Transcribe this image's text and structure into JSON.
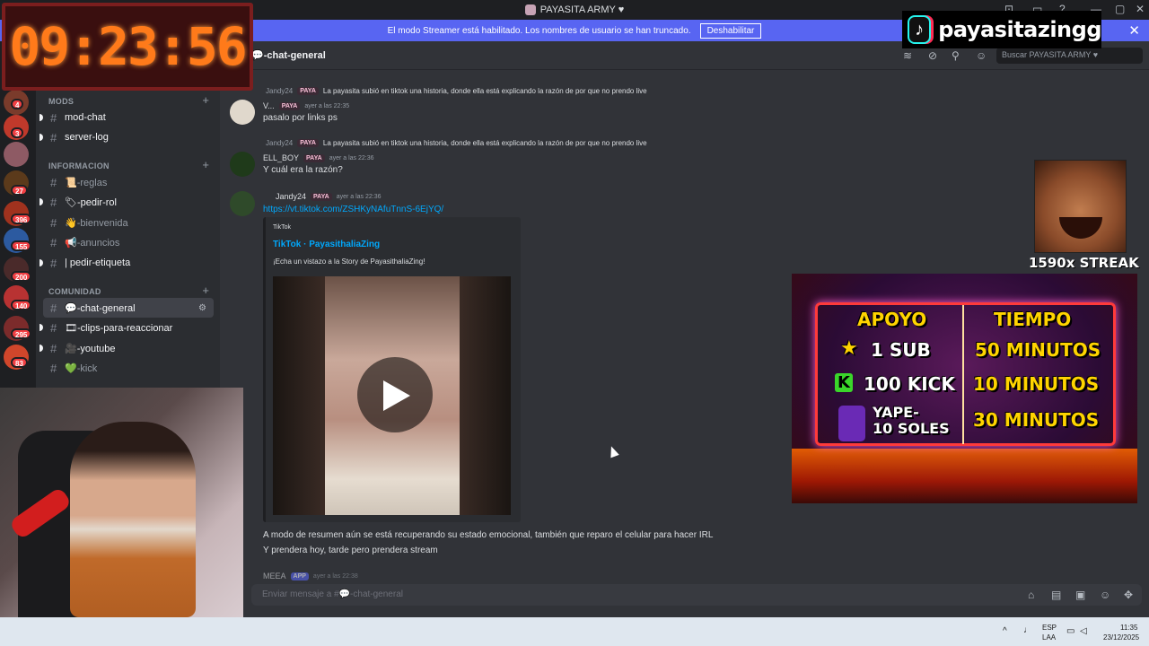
{
  "window": {
    "title": "PAYASITA ARMY ♥"
  },
  "banner": {
    "text": "El modo Streamer está habilitado. Los nombres de usuario se han truncado.",
    "button": "Deshabilitar",
    "close": "✕"
  },
  "rail": {
    "badges": [
      "4",
      "3",
      "27",
      "396",
      "155",
      "200",
      "140",
      "295",
      "83"
    ]
  },
  "sidebar": {
    "categories": {
      "mods": "MODS",
      "info": "INFORMACION",
      "comunidad": "COMUNIDAD"
    },
    "channels": [
      {
        "label": "mod-chat"
      },
      {
        "label": "server-log"
      },
      {
        "label": "📜-reglas"
      },
      {
        "label": "🏷-pedir-rol"
      },
      {
        "label": "👋-bienvenida"
      },
      {
        "label": "📢-anuncios"
      },
      {
        "label": "| pedir-etiqueta"
      },
      {
        "label": "💬-chat-general"
      },
      {
        "label": "🎞-clips-para-reaccionar"
      },
      {
        "label": "🎥-youtube"
      },
      {
        "label": "💚-kick"
      }
    ]
  },
  "header": {
    "channel": "💬-chat-general",
    "search_placeholder": "Buscar PAYASITA ARMY ♥"
  },
  "messages": [
    {
      "reply_name": "Jandy24",
      "reply_tag": "PAYA",
      "reply_text": "La payasita subió en tiktok una historia, donde ella está explicando la razón de por que no prendo live",
      "author": "V...",
      "tag": "PAYA",
      "time": "ayer a las 22:35",
      "text": "pasalo por links ps"
    },
    {
      "reply_name": "Jandy24",
      "reply_tag": "PAYA",
      "reply_text": "La payasita subió en tiktok una historia, donde ella está explicando la razón de por que no prendo live",
      "author": "ELL_BOY",
      "tag": "PAYA",
      "time": "ayer a las 22:36",
      "text": "Y cuál era la razón?"
    },
    {
      "author": "Jandy24",
      "tag": "PAYA",
      "time": "ayer a las 22:36",
      "link": "https://vt.tiktok.com/ZSHKyNAfuTnnS-6EjYQ/",
      "embed_provider": "TikTok",
      "embed_title": "TikTok · PayasithaliaZing",
      "embed_desc": "¡Echa un vistazo a la Story de PayasithaliaZing!",
      "line1": "A modo de resumen aún se está recuperando su estado emocional, también que reparo el celular para hacer IRL",
      "line2": "Y prendera hoy, tarde pero prendera stream"
    },
    {
      "author": "MEEA",
      "tag": "APP",
      "time": "ayer a las 22:38"
    }
  ],
  "composer": {
    "placeholder": "Enviar mensaje a #💬-chat-general"
  },
  "taskbar": {
    "lang1": "ESP",
    "lang2": "LAA",
    "time": "11:35",
    "date": "23/12/2025"
  },
  "overlay": {
    "clock": "09:23:56",
    "brand": "payasitazingg",
    "streak": "1590x STREAK",
    "donate": {
      "h1": "APOYO",
      "h2": "TIEMPO",
      "r1a": "1 SUB",
      "r1b": "50 MINUTOS",
      "r2a": "100 KICK",
      "r2b": "10 MINUTOS",
      "r3a": "YAPE-",
      "r3a2": "10 SOLES",
      "r3b": "30 MINUTOS"
    }
  }
}
